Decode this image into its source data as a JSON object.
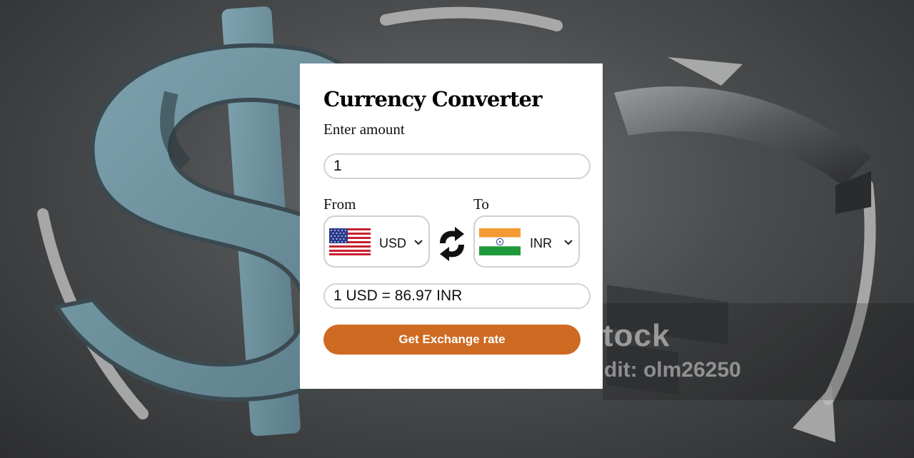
{
  "app": {
    "title": "Currency Converter"
  },
  "amount": {
    "label": "Enter amount",
    "value": "1"
  },
  "from": {
    "label": "From",
    "currency": "USD",
    "flag_icon": "us-flag-icon"
  },
  "to": {
    "label": "To",
    "currency": "INR",
    "flag_icon": "india-flag-icon"
  },
  "swap_icon": "swap-arrows-icon",
  "result": {
    "text": "1 USD = 86.97 INR"
  },
  "button": {
    "label": "Get Exchange rate"
  },
  "background": {
    "watermark_brand": "tock",
    "watermark_credit": "dit: olm26250"
  },
  "colors": {
    "accent": "#cf6a23",
    "input_border": "#d2d2d2",
    "card": "#ffffff",
    "dollar_sign": "#6d8e9a"
  }
}
